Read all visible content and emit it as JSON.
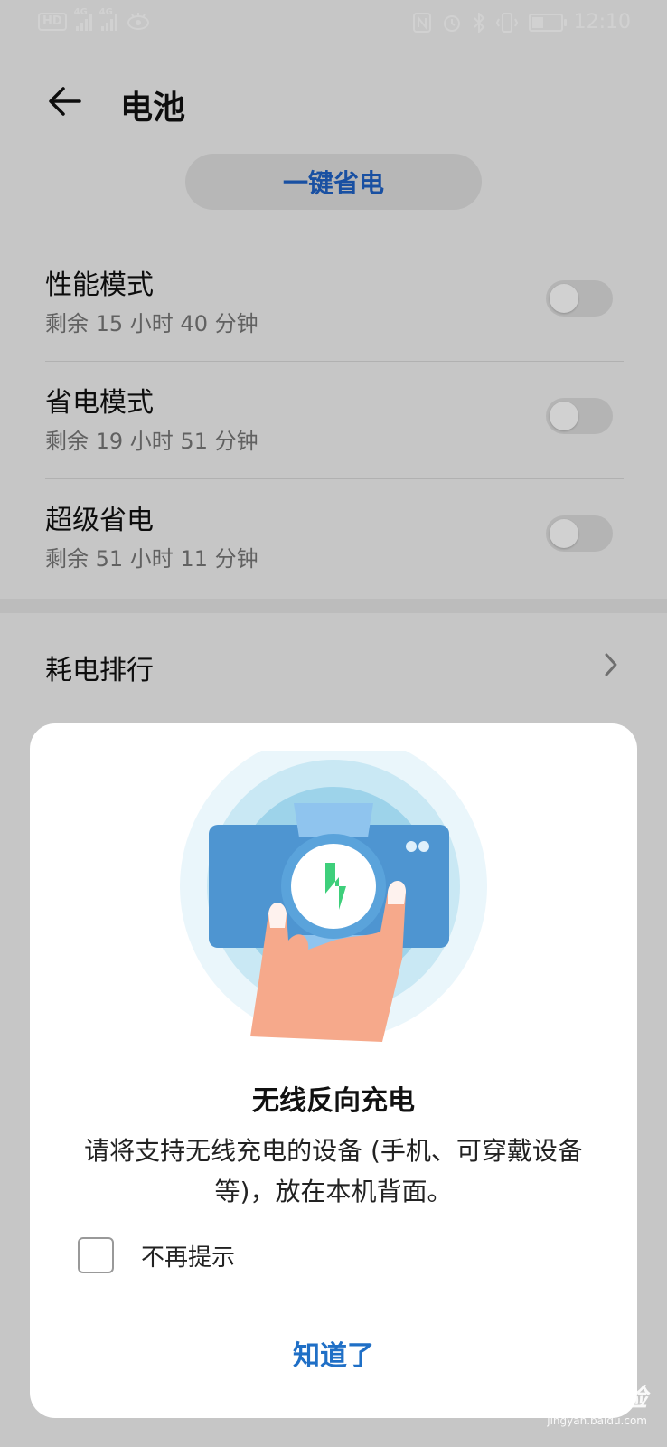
{
  "status_bar": {
    "left_chips": [
      "HD",
      "4G",
      "4G"
    ],
    "time": "12:10",
    "icons": [
      "nfc-icon",
      "alarm-icon",
      "bluetooth-icon",
      "vibrate-icon",
      "battery-icon"
    ]
  },
  "header": {
    "title": "电池"
  },
  "one_key": {
    "label": "一键省电"
  },
  "modes": [
    {
      "label": "性能模式",
      "sub": "剩余 15 小时 40 分钟",
      "enabled": false
    },
    {
      "label": "省电模式",
      "sub": "剩余 19 小时 51 分钟",
      "enabled": false
    },
    {
      "label": "超级省电",
      "sub": "剩余 51 小时 11 分钟",
      "enabled": false
    }
  ],
  "rank": {
    "label": "耗电排行"
  },
  "dialog": {
    "title": "无线反向充电",
    "text": "请将支持无线充电的设备 (手机、可穿戴设备等)，放在本机背面。",
    "checkbox_label": "不再提示",
    "checkbox_checked": false,
    "ok_label": "知道了"
  },
  "watermark": {
    "logo": "Baidu经验",
    "url": "jingyan.baidu.com"
  },
  "colors": {
    "accent": "#1f62c6",
    "dialog_button": "#1f6fc6"
  }
}
